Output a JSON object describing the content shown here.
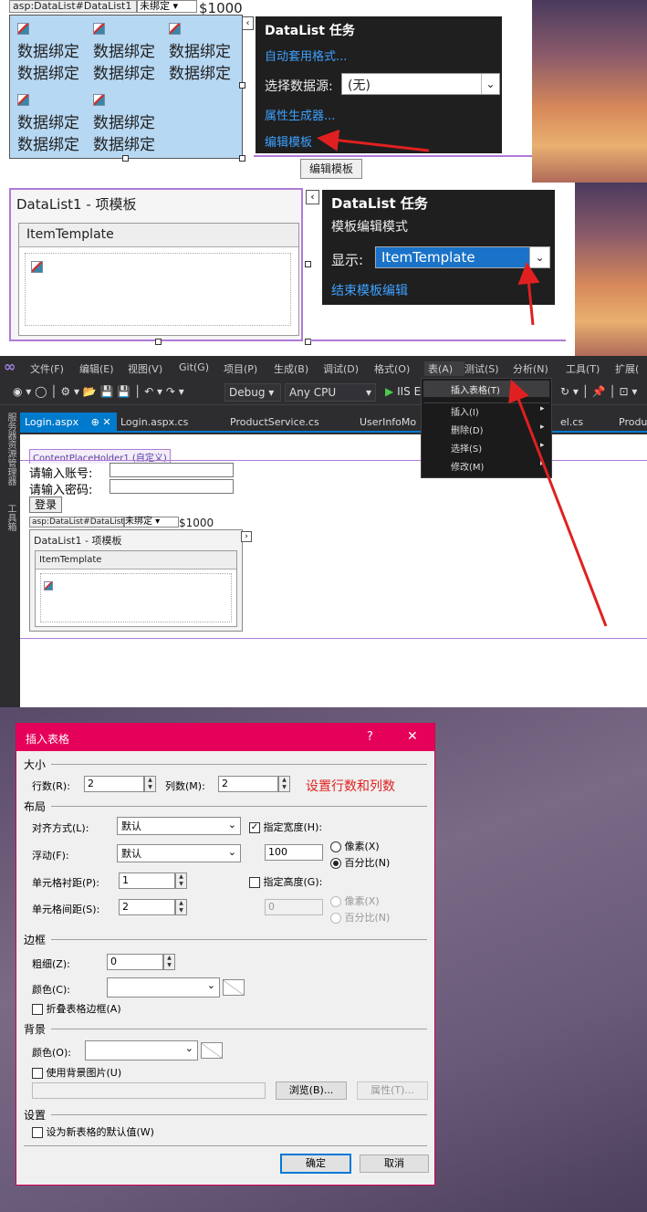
{
  "panel1": {
    "tag": "asp:DataList#DataList1",
    "tag_drop": "未绑定",
    "price": "$1000",
    "cell": "数据绑定",
    "task": {
      "title": "DataList 任务",
      "autoformat": "自动套用格式...",
      "ds_label": "选择数据源:",
      "ds_value": "(无)",
      "prop": "属性生成器...",
      "edit": "编辑模板"
    },
    "tooltip": "编辑模板"
  },
  "panel2": {
    "title": "DataList1 - 项模板",
    "template": "ItemTemplate",
    "task": {
      "title": "DataList 任务",
      "mode": "模板编辑模式",
      "show_label": "显示:",
      "show_value": "ItemTemplate",
      "end": "结束模板编辑"
    }
  },
  "vs": {
    "menu": [
      "文件(F)",
      "编辑(E)",
      "视图(V)",
      "Git(G)",
      "项目(P)",
      "生成(B)",
      "调试(D)",
      "格式(O)",
      "表(A)",
      "测试(S)",
      "分析(N)",
      "工具(T)",
      "扩展("
    ],
    "toolbar": {
      "config": "Debug",
      "platform": "Any CPU",
      "run": "IIS E"
    },
    "tabs": [
      "Login.aspx",
      "Login.aspx.cs",
      "ProductService.cs",
      "UserInfoMo",
      "el.cs",
      "Produ"
    ],
    "side": [
      "服务器资源管理器",
      "工具箱"
    ],
    "dropdown": [
      {
        "label": "插入表格(T)"
      },
      {
        "label": "插入(I)"
      },
      {
        "label": "删除(D)"
      },
      {
        "label": "选择(S)"
      },
      {
        "label": "修改(M)"
      }
    ],
    "design": {
      "placeholder": "ContentPlaceHolder1 (自定义)",
      "account": "请输入账号:",
      "password": "请输入密码:",
      "login": "登录",
      "tag": "asp:DataList#DataList1",
      "tag_drop": "未绑定",
      "price": "$1000",
      "tpl_title": "DataList1 - 项模板",
      "tpl_name": "ItemTemplate"
    }
  },
  "dialog": {
    "title": "插入表格",
    "help": "?",
    "close": "✕",
    "size": "大小",
    "rows_label": "行数(R):",
    "rows": "2",
    "cols_label": "列数(M):",
    "cols": "2",
    "annotation": "设置行数和列数",
    "layout": "布局",
    "align_label": "对齐方式(L):",
    "align": "默认",
    "width_chk": "指定宽度(H):",
    "float_label": "浮动(F):",
    "float": "默认",
    "width": "100",
    "px": "像素(X)",
    "pct": "百分比(N)",
    "padding_label": "单元格衬距(P):",
    "padding": "1",
    "height_chk": "指定高度(G):",
    "spacing_label": "单元格间距(S):",
    "spacing": "2",
    "height": "0",
    "px2": "像素(X)",
    "pct2": "百分比(N)",
    "border": "边框",
    "thick_label": "粗细(Z):",
    "thick": "0",
    "color_label": "颜色(C):",
    "collapse": "折叠表格边框(A)",
    "bg": "背景",
    "bgcolor_label": "颜色(O):",
    "bgimg": "使用背景图片(U)",
    "browse": "浏览(B)...",
    "attr": "属性(T)...",
    "settings": "设置",
    "default": "设为新表格的默认值(W)",
    "ok": "确定",
    "cancel": "取消"
  },
  "colors": {
    "accent_red": "#e5005a",
    "arrow": "#e02020",
    "link": "#3ea0ff",
    "selection": "#b7d8f3"
  }
}
